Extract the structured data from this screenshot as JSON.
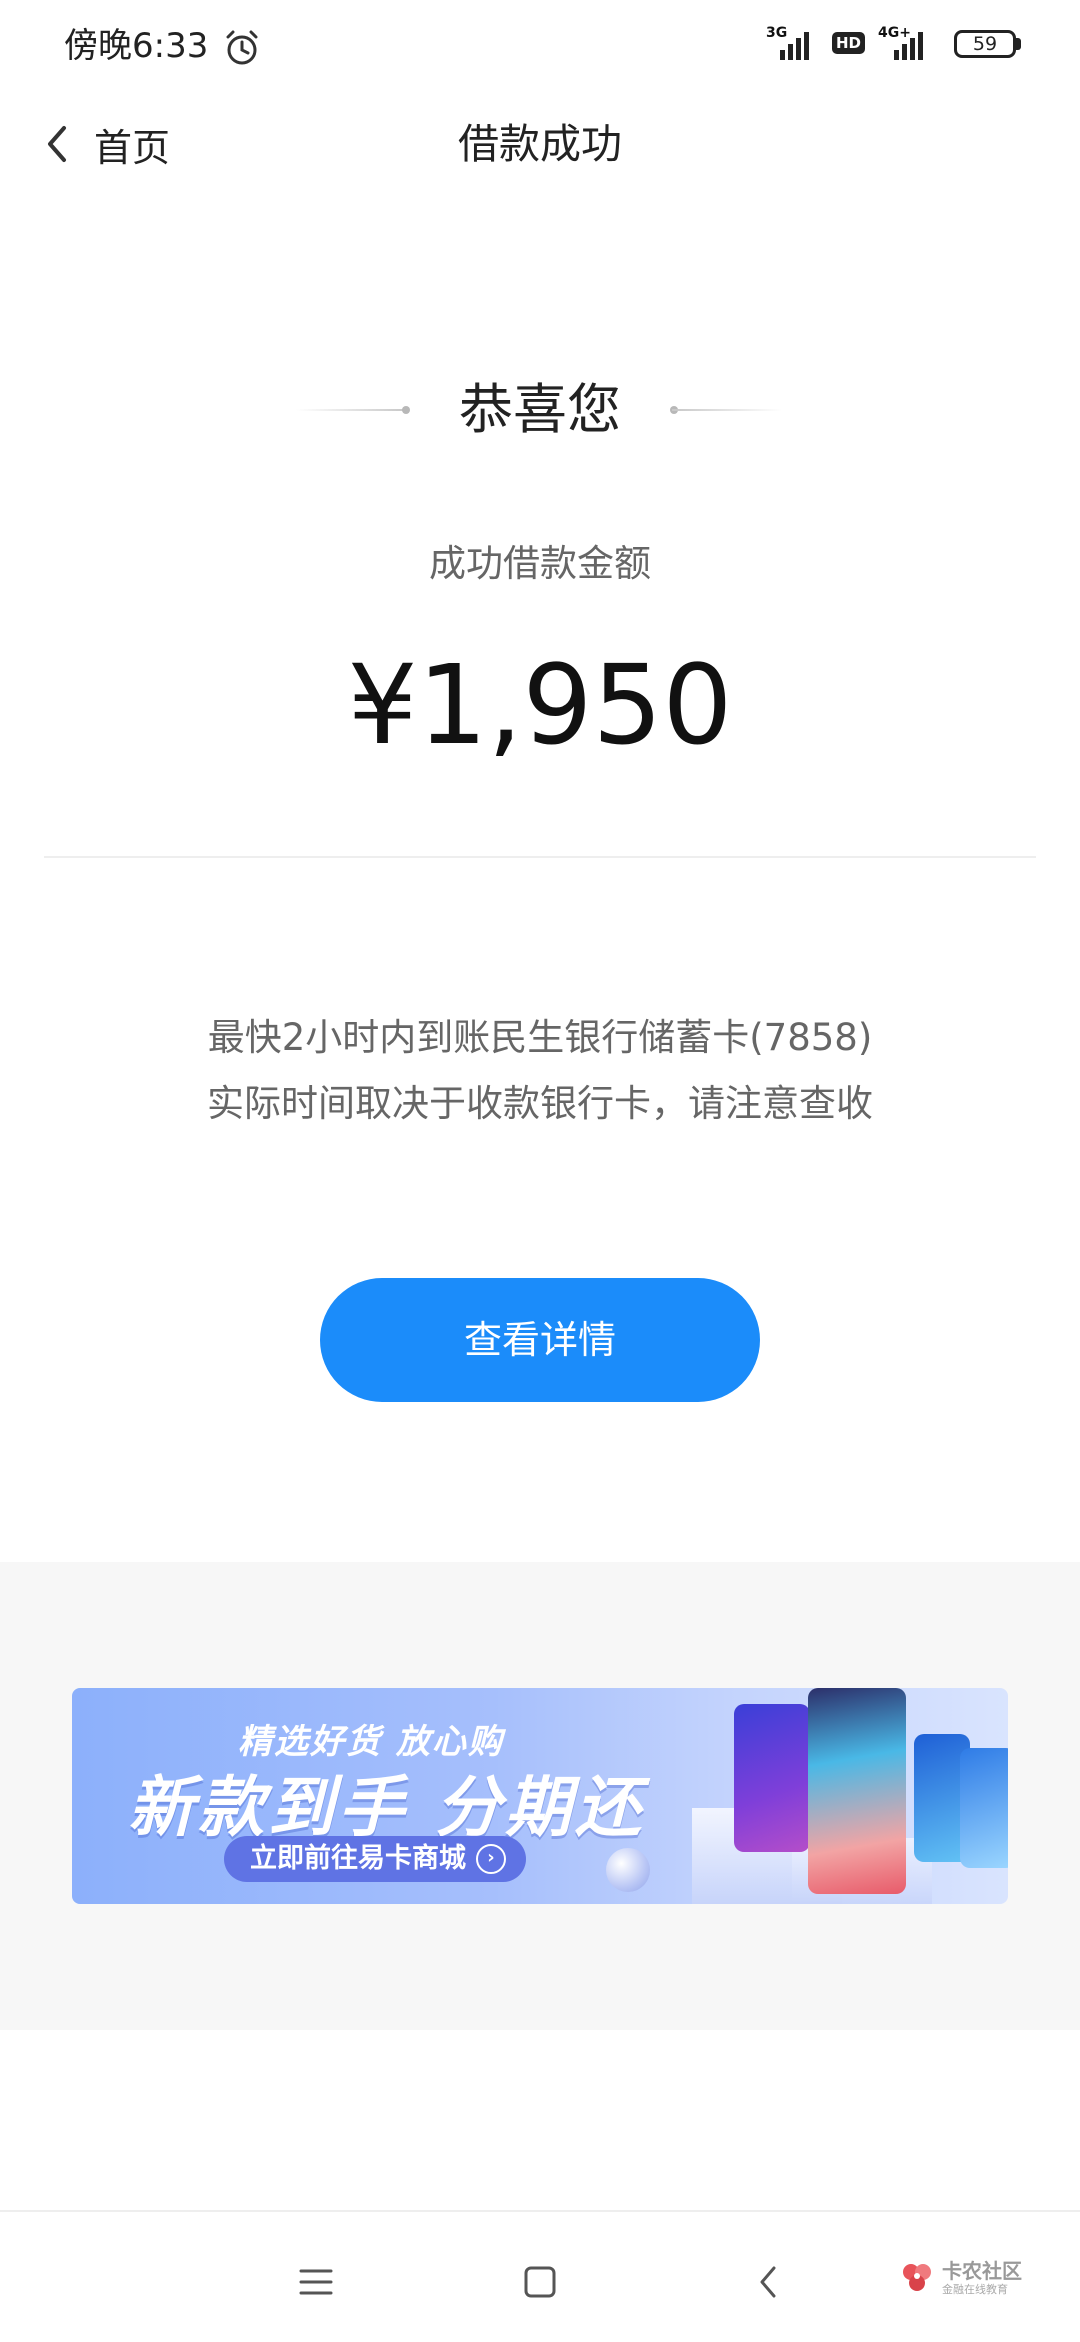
{
  "status_bar": {
    "time": "傍晚6:33",
    "net1": "3G",
    "hd": "HD",
    "net2": "4G+",
    "battery": "59"
  },
  "nav": {
    "back_label": "首页",
    "title": "借款成功"
  },
  "result": {
    "congrats": "恭喜您",
    "amount_label": "成功借款金额",
    "amount": "¥1,950",
    "info_line1": "最快2小时内到账民生银行储蓄卡(7858)",
    "info_line2": "实际时间取决于收款银行卡，请注意查收",
    "detail_button": "查看详情"
  },
  "banner": {
    "line1": "精选好货 放心购",
    "line2": "新款到手 分期还",
    "cta": "立即前往易卡商城"
  },
  "watermark": {
    "title": "卡农社区",
    "subtitle": "金融在线教育"
  },
  "colors": {
    "accent": "#1b8cfa",
    "banner": "#9db8fb"
  }
}
